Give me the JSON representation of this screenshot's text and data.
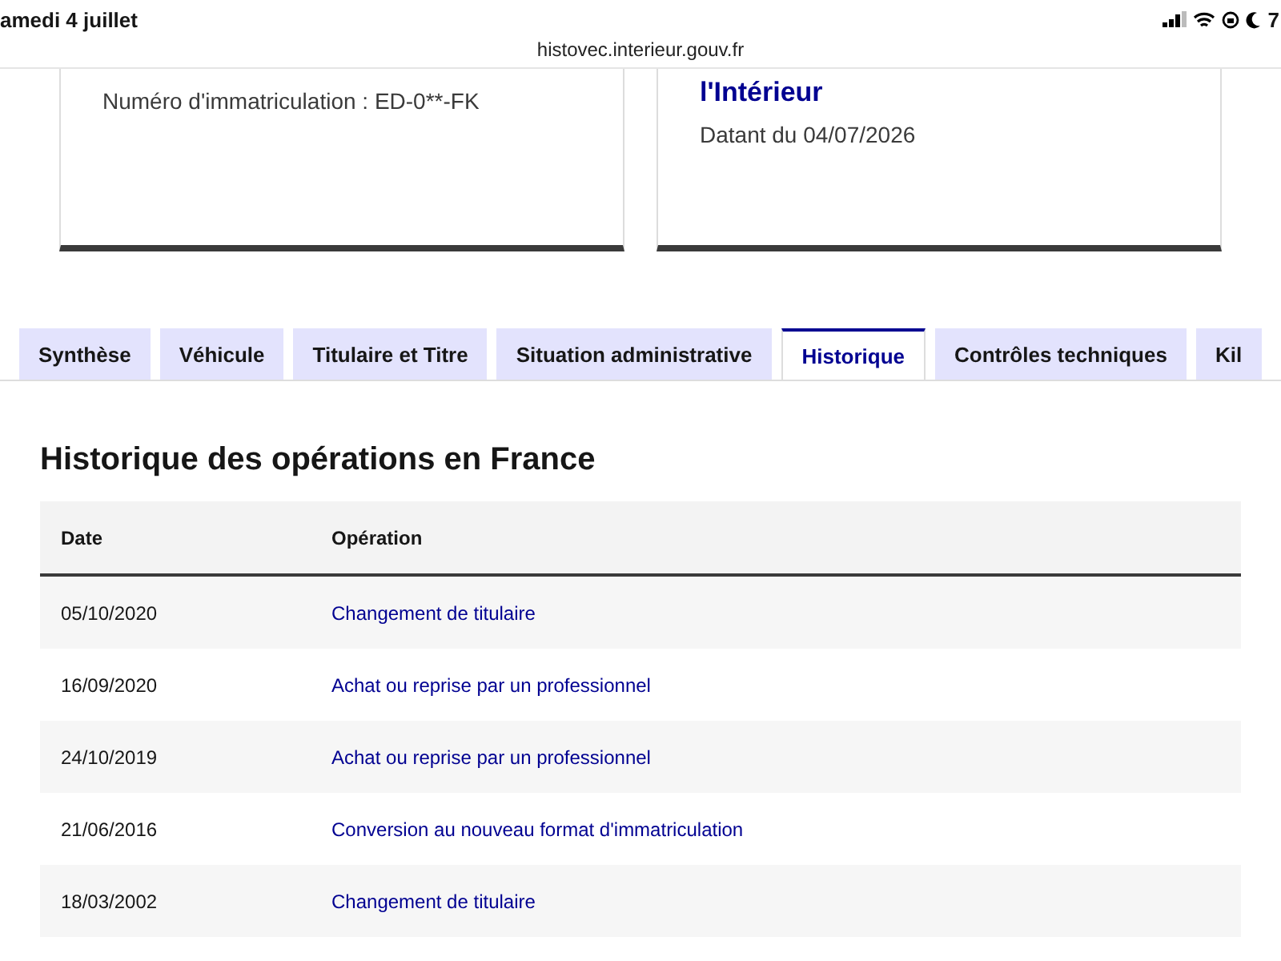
{
  "status_bar": {
    "date": "amedi 4 juillet",
    "battery_text": "7"
  },
  "address_bar": {
    "url": "histovec.interieur.gouv.fr"
  },
  "cards": [
    {
      "lines": [
        "Numéro d'immatriculation : ED-0**-FK"
      ]
    },
    {
      "title": "l'Intérieur",
      "lines": [
        "Datant du 04/07/2026"
      ]
    }
  ],
  "tabs": [
    {
      "label": "Synthèse",
      "selected": false
    },
    {
      "label": "Véhicule",
      "selected": false
    },
    {
      "label": "Titulaire et Titre",
      "selected": false
    },
    {
      "label": "Situation administrative",
      "selected": false
    },
    {
      "label": "Historique",
      "selected": true
    },
    {
      "label": "Contrôles techniques",
      "selected": false
    },
    {
      "label": "Kil",
      "selected": false
    }
  ],
  "section": {
    "title": "Historique des opérations en France",
    "table": {
      "columns": [
        "Date",
        "Opération"
      ],
      "rows": [
        [
          "05/10/2020",
          "Changement de titulaire"
        ],
        [
          "16/09/2020",
          "Achat ou reprise par un professionnel"
        ],
        [
          "24/10/2019",
          "Achat ou reprise par un professionnel"
        ],
        [
          "21/06/2016",
          "Conversion au nouveau format d'immatriculation"
        ],
        [
          "18/03/2002",
          "Changement de titulaire"
        ]
      ]
    }
  }
}
